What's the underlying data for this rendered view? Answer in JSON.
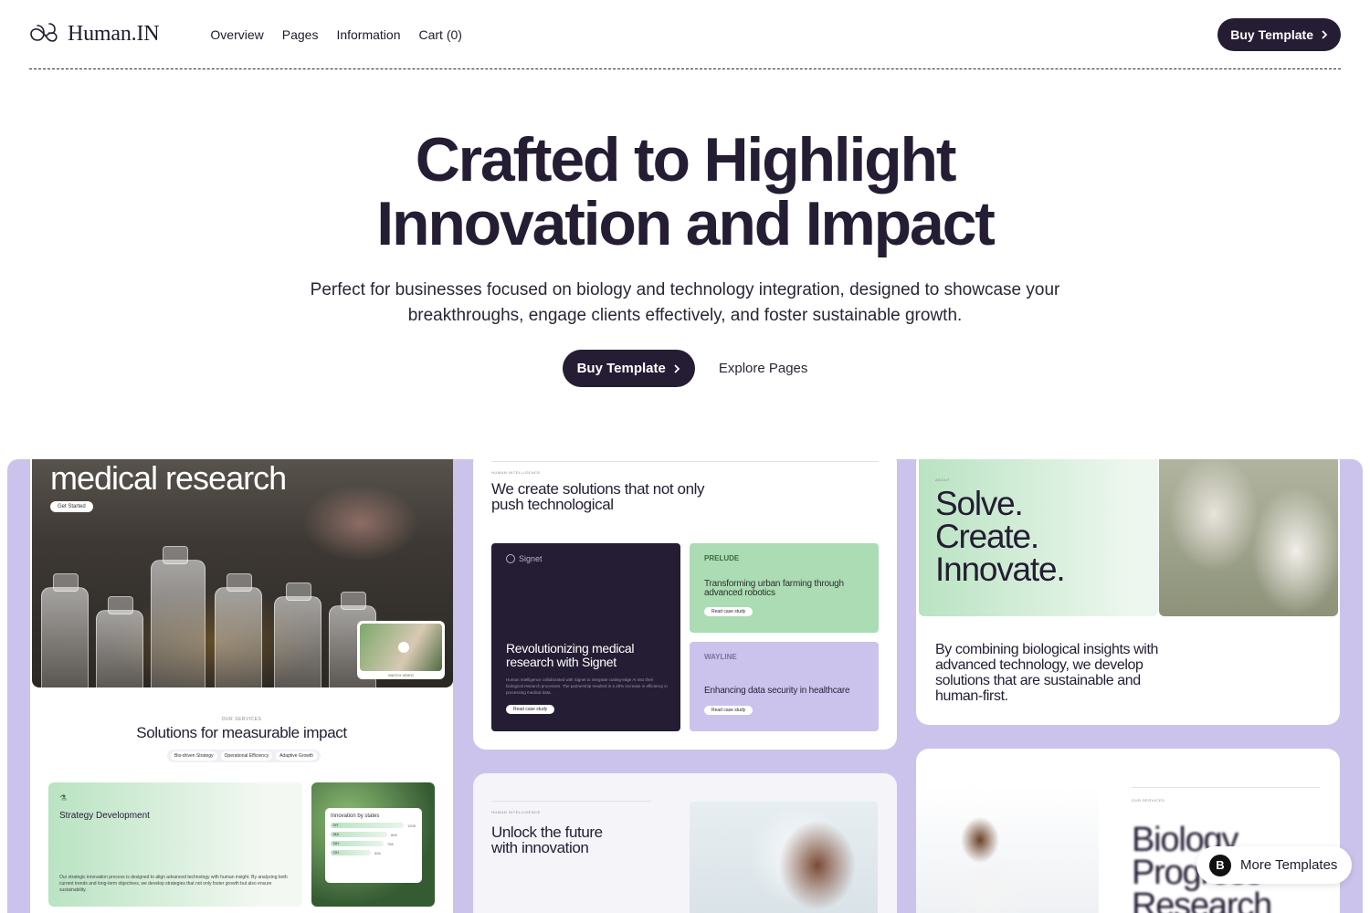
{
  "nav": {
    "brand": "Human.IN",
    "links": [
      "Overview",
      "Pages",
      "Information",
      "Cart (0)"
    ],
    "buy_label": "Buy Template"
  },
  "hero": {
    "title_line1": "Crafted to Highlight",
    "title_line2": "Innovation and Impact",
    "subtitle": "Perfect for businesses focused on biology and technology integration, designed to showcase your breakthroughs, engage clients effectively, and foster sustainable growth.",
    "buy_label": "Buy Template",
    "explore_label": "Explore Pages"
  },
  "showcase": {
    "card1": {
      "headline": "medical research",
      "button": "Get Started",
      "video_caption": "WATCH VIDEO",
      "eyebrow": "OUR SERVICES",
      "title": "Solutions for measurable impact",
      "tabs": [
        "Bio-driven Strategy",
        "Operational Efficiency",
        "Adaptive Growth"
      ],
      "strategy_title": "Strategy Development",
      "strategy_body": "Our strategic innovation process is designed to align advanced technology with human insight. By analyzing both current trends and long-term objectives, we develop strategies that not only foster growth but also ensure sustainability.",
      "states_title": "Innovation by states",
      "states": [
        {
          "code": "NY",
          "value": "120K"
        },
        {
          "code": "MA",
          "value": "80K"
        },
        {
          "code": "NH",
          "value": "75K"
        },
        {
          "code": "OH",
          "value": "50K"
        }
      ]
    },
    "card2": {
      "eyebrow": "HUMAN INTELLIGENCE",
      "title": "We create solutions that not only push technological",
      "signet_logo": "Signet",
      "signet_title": "Revolutionizing medical research with Signet",
      "signet_body": "Human Intelligence collaborated with Signet to integrate cutting-edge AI into their biological research processes. The partnership resulted in a 40% increase in efficiency in processing medical data.",
      "signet_button": "Read case study",
      "prelude_logo": "PRELUDE",
      "prelude_body": "Transforming urban farming through advanced robotics",
      "prelude_button": "Read case study",
      "wayline_logo": "WAYLINE",
      "wayline_body": "Enhancing data security in healthcare",
      "wayline_button": "Read case study"
    },
    "card3": {
      "eyebrow": "ABOUT",
      "head_1": "Solve.",
      "head_2": "Create.",
      "head_3": "Innovate.",
      "body": "By combining biological insights with advanced technology, we develop solutions that are sustainable and human-first."
    },
    "card4": {
      "eyebrow": "HUMAN INTELLIGENCE",
      "title": "Unlock the future with innovation"
    },
    "card5": {
      "eyebrow": "OUR SERVICES",
      "title_1": "Biology",
      "title_2": "Progress",
      "title_3": "Research"
    }
  },
  "floating": {
    "more_templates": "More Templates",
    "badge": "B"
  },
  "colors": {
    "ink": "#241d33",
    "lavender": "#cbc3ec",
    "mint": "#abdcb4"
  }
}
